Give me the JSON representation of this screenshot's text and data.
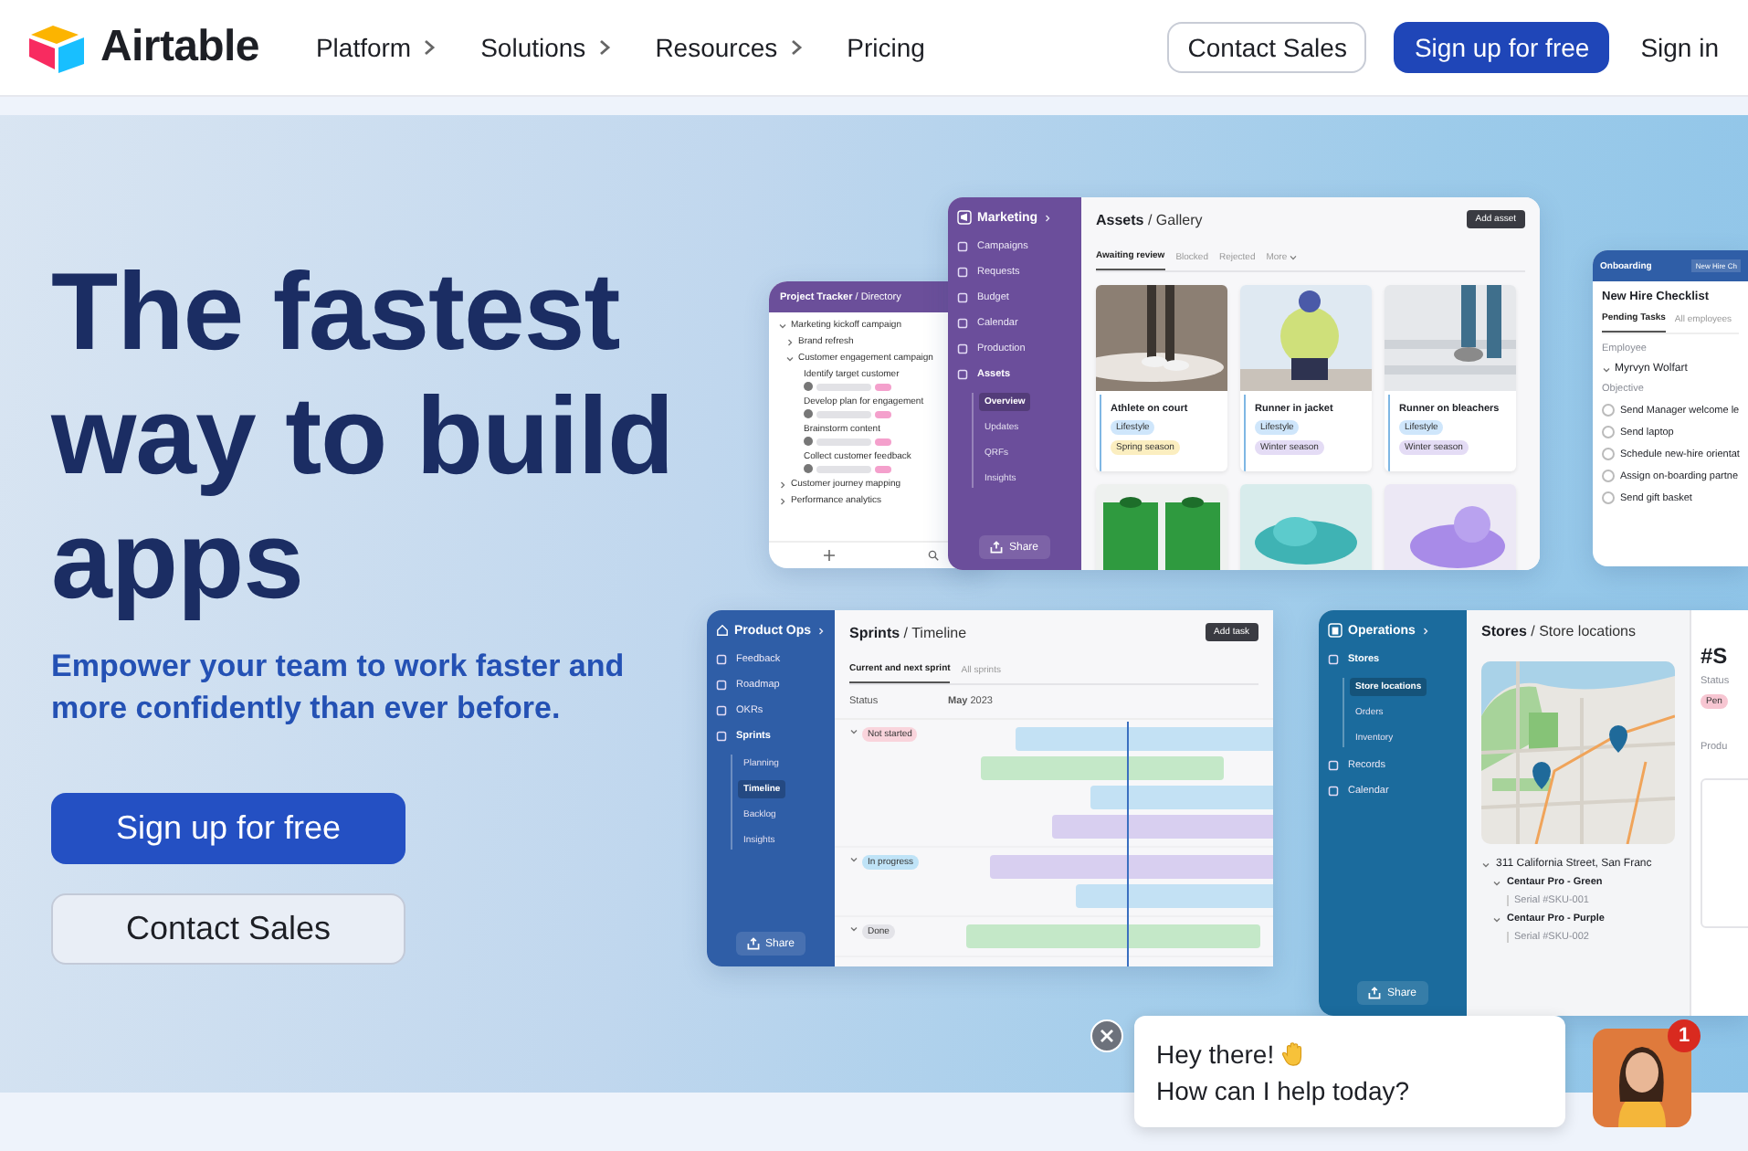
{
  "nav": {
    "brand": "Airtable",
    "links": [
      {
        "label": "Platform",
        "has_menu": true
      },
      {
        "label": "Solutions",
        "has_menu": true
      },
      {
        "label": "Resources",
        "has_menu": true
      },
      {
        "label": "Pricing",
        "has_menu": false
      }
    ],
    "actions": [
      {
        "label": "Contact Sales",
        "kind": "outline"
      },
      {
        "label": "Sign up for free",
        "kind": "primary"
      },
      {
        "label": "Sign in",
        "kind": "link"
      }
    ]
  },
  "hero": {
    "title": "The fastest way to build apps",
    "subtitle": "Empower your team to work faster and more confidently than ever before.",
    "buttons": [
      {
        "label": "Sign up for free",
        "kind": "primary"
      },
      {
        "label": "Contact Sales",
        "kind": "secondary"
      }
    ]
  },
  "phone": {
    "title": "**Project Tracker** / Directory",
    "tree": [
      {
        "label": "Marketing kickoff campaign",
        "kind": "group",
        "expanded": true,
        "children": [
          {
            "label": "Brand refresh",
            "kind": "group",
            "expanded": false
          },
          {
            "label": "Customer engagement campaign",
            "kind": "group",
            "expanded": true,
            "children": [
              {
                "label": "Identify target customer",
                "kind": "task"
              },
              {
                "label": "Develop plan for engagement",
                "kind": "task"
              },
              {
                "label": "Brainstorm content",
                "kind": "task"
              },
              {
                "label": "Collect customer feedback",
                "kind": "task"
              }
            ]
          }
        ]
      },
      {
        "label": "Customer journey mapping",
        "kind": "group",
        "expanded": false
      },
      {
        "label": "Performance analytics",
        "kind": "group",
        "expanded": false
      }
    ]
  },
  "marketing": {
    "workspace": "Marketing",
    "nav": [
      {
        "label": "Campaigns",
        "selected": false
      },
      {
        "label": "Requests",
        "selected": false
      },
      {
        "label": "Budget",
        "selected": false
      },
      {
        "label": "Calendar",
        "selected": false
      },
      {
        "label": "Production",
        "selected": false
      },
      {
        "label": "Assets",
        "selected": false,
        "expanded": true,
        "children": [
          {
            "label": "Overview",
            "selected": true
          },
          {
            "label": "Updates",
            "selected": false
          },
          {
            "label": "QRFs",
            "selected": false
          },
          {
            "label": "Insights",
            "selected": false
          }
        ]
      }
    ],
    "share": "Share",
    "breadcrumb": "**Assets** / Gallery",
    "action": "Add asset",
    "tabs": [
      {
        "label": "Awaiting review",
        "selected": true,
        "has_menu": false
      },
      {
        "label": "Blocked",
        "selected": false,
        "has_menu": false
      },
      {
        "label": "Rejected",
        "selected": false,
        "has_menu": false
      },
      {
        "label": "More",
        "selected": false,
        "has_menu": true
      }
    ],
    "cards": [
      {
        "kind": "captioned",
        "title": "Athlete on court",
        "tags": [
          {
            "label": "Lifestyle",
            "color": "#cfe6fb"
          },
          {
            "label": "Spring season",
            "color": "#fbeec0"
          }
        ]
      },
      {
        "kind": "captioned",
        "title": "Runner in jacket",
        "tags": [
          {
            "label": "Lifestyle",
            "color": "#cfe6fb"
          },
          {
            "label": "Winter season",
            "color": "#e4dcf5"
          }
        ]
      },
      {
        "kind": "captioned",
        "title": "Runner on bleachers",
        "tags": [
          {
            "label": "Lifestyle",
            "color": "#cfe6fb"
          },
          {
            "label": "Winter season",
            "color": "#e4dcf5"
          }
        ]
      },
      {
        "kind": "image_only"
      },
      {
        "kind": "image_only"
      },
      {
        "kind": "image_only"
      }
    ]
  },
  "onboarding": {
    "workspace": "Onboarding",
    "action": "New Hire Ch",
    "title": "New Hire Checklist",
    "tabs": [
      {
        "label": "Pending Tasks",
        "selected": true
      },
      {
        "label": "All employees",
        "selected": false
      }
    ],
    "field_label": "Employee",
    "employee": "Myrvyn Wolfart",
    "column": "Objective",
    "tasks": [
      {
        "label": "Send Manager welcome le",
        "checked": false
      },
      {
        "label": "Send laptop",
        "checked": false
      },
      {
        "label": "Schedule new-hire orientat",
        "checked": false
      },
      {
        "label": "Assign on-boarding partne",
        "checked": false
      },
      {
        "label": "Send gift basket",
        "checked": false
      }
    ]
  },
  "product_ops": {
    "workspace": "Product Ops",
    "nav": [
      {
        "label": "Feedback",
        "selected": false
      },
      {
        "label": "Roadmap",
        "selected": false
      },
      {
        "label": "OKRs",
        "selected": false
      },
      {
        "label": "Sprints",
        "selected": false,
        "expanded": true,
        "children": [
          {
            "label": "Planning",
            "selected": false
          },
          {
            "label": "Timeline",
            "selected": true
          },
          {
            "label": "Backlog",
            "selected": false
          },
          {
            "label": "Insights",
            "selected": false
          }
        ]
      }
    ],
    "share": "Share",
    "breadcrumb": "**Sprints** / Timeline",
    "action": "Add task",
    "tabs": [
      {
        "label": "Current and next sprint",
        "selected": true
      },
      {
        "label": "All sprints",
        "selected": false
      }
    ],
    "status_header": "Status",
    "month": "**May** 2023",
    "groups": [
      {
        "label": "Not started",
        "color": "#f9d4dc",
        "expanded": true,
        "bars": [
          {
            "color": "#c3e1f4"
          },
          {
            "color": "#c4e8c8"
          },
          {
            "color": "#c3e1f4"
          },
          {
            "color": "#d8cff0"
          }
        ]
      },
      {
        "label": "In progress",
        "color": "#bfe3f7",
        "expanded": true,
        "bars": [
          {
            "color": "#d8cff0"
          },
          {
            "color": "#c3e1f4"
          }
        ]
      },
      {
        "label": "Done",
        "color": "#e3e3e8",
        "expanded": true,
        "bars": [
          {
            "color": "#c4e8c8"
          }
        ]
      }
    ]
  },
  "operations": {
    "workspace": "Operations",
    "nav": [
      {
        "label": "Stores",
        "selected": false,
        "expanded": true,
        "children": [
          {
            "label": "Store locations",
            "selected": true
          },
          {
            "label": "Orders",
            "selected": false
          },
          {
            "label": "Inventory",
            "selected": false
          }
        ]
      },
      {
        "label": "Records",
        "selected": false
      },
      {
        "label": "Calendar",
        "selected": false
      }
    ],
    "share": "Share",
    "breadcrumb": "**Stores** / Store locations",
    "address": "311 California Street, San Franc",
    "products": [
      {
        "name": "Centaur Pro - Green",
        "serial": "Serial #SKU-001",
        "expanded": true
      },
      {
        "name": "Centaur Pro - Purple",
        "serial": "Serial #SKU-002",
        "expanded": true
      }
    ],
    "detail": {
      "heading": "#S",
      "field_label": "Status",
      "tag": {
        "label": "Pen",
        "color": "#f7c6d2"
      },
      "section": "Produ"
    }
  },
  "chat": {
    "greeting": "Hey there!",
    "question": "How can I help today?",
    "unread": "1"
  }
}
